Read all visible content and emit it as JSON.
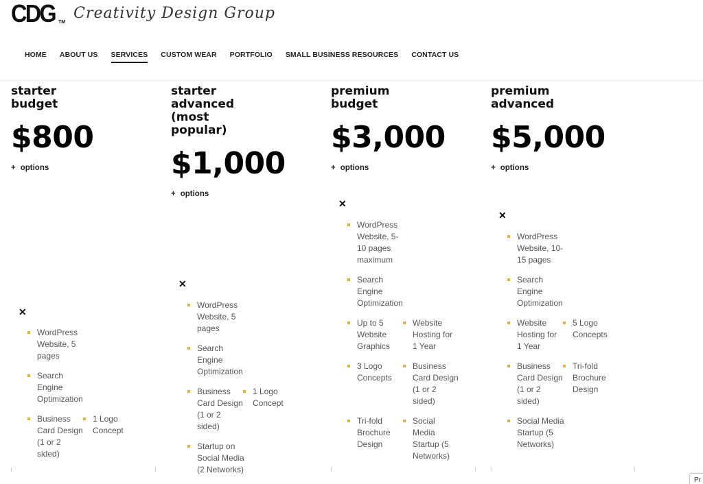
{
  "brand": {
    "mark": "CDG",
    "tm": "TM",
    "script": "Creativity Design Group"
  },
  "nav": {
    "items": [
      {
        "label": "HOME"
      },
      {
        "label": "ABOUT US"
      },
      {
        "label": "SERVICES",
        "active": true
      },
      {
        "label": "CUSTOM WEAR"
      },
      {
        "label": "PORTFOLIO"
      },
      {
        "label": "SMALL BUSINESS RESOURCES"
      },
      {
        "label": "CONTACT US"
      }
    ]
  },
  "accent_color": "#e8b23a",
  "plans": [
    {
      "title": "starter\nbudget",
      "price": "$800",
      "options_label": "options",
      "options_icon": "plus-icon",
      "close_icon": "close-icon",
      "features": [
        {
          "text": "WordPress Website, 5 pages"
        },
        {
          "text": "Search Engine Optimization"
        },
        {
          "text": "Business Card Design (1 or 2 sided)"
        },
        {
          "text": "1 Logo Concept"
        }
      ]
    },
    {
      "title": "starter\nadvanced\n(most\npopular)",
      "price": "$1,000",
      "options_label": "options",
      "options_icon": "plus-icon",
      "close_icon": "close-icon",
      "features": [
        {
          "text": "WordPress Website, 5 pages"
        },
        {
          "text": "Search Engine Optimization"
        },
        {
          "text": "Business Card Design (1 or 2 sided)"
        },
        {
          "text": "1 Logo Concept"
        },
        {
          "text": "Startup on Social Media (2 Networks)"
        }
      ]
    },
    {
      "title": "premium\nbudget",
      "price": "$3,000",
      "options_label": "options",
      "options_icon": "plus-icon",
      "close_icon": "close-icon",
      "features": [
        {
          "text": "WordPress Website, 5-10 pages maximum"
        },
        {
          "text": "Search Engine Optimization"
        },
        {
          "text": "Up to 5 Website Graphics"
        },
        {
          "text": "Website Hosting for 1 Year"
        },
        {
          "text": "3 Logo Concepts"
        },
        {
          "text": "Business Card Design (1 or 2 sided)"
        },
        {
          "text": "Tri-fold Brochure Design"
        },
        {
          "text": "Social Media Startup (5 Networks)"
        }
      ]
    },
    {
      "title": "premium\nadvanced",
      "price": "$5,000",
      "options_label": "options",
      "options_icon": "plus-icon",
      "close_icon": "close-icon",
      "features": [
        {
          "text": "WordPress Website, 10-15 pages"
        },
        {
          "text": "Search Engine Optimization"
        },
        {
          "text": "Website Hosting for 1 Year"
        },
        {
          "text": "5 Logo Concepts"
        },
        {
          "text": "Business Card Design (1 or 2 sided)"
        },
        {
          "text": "Tri-fold Brochure Design"
        },
        {
          "text": "Social Media Startup (5 Networks)"
        }
      ]
    }
  ],
  "corner_widget": {
    "label": "Pr"
  }
}
